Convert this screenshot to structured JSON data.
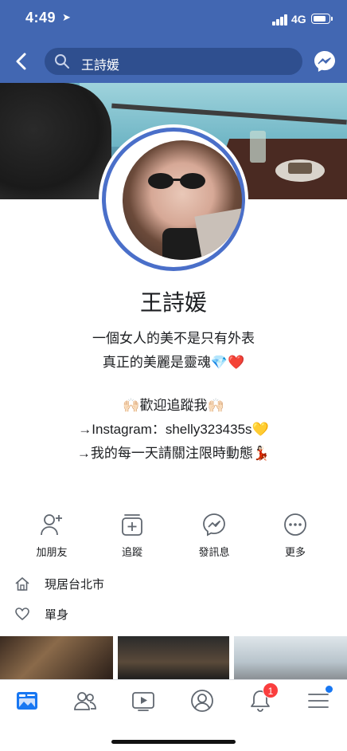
{
  "status_bar": {
    "time": "4:49",
    "network": "4G",
    "battery_level": 0.85
  },
  "header": {
    "search_query": "王詩媛",
    "icons": [
      "back-arrow-icon",
      "search-icon",
      "messenger-icon"
    ]
  },
  "profile": {
    "name": "王詩媛",
    "bio_lines": [
      "一個女人的美不是只有外表",
      "真正的美麗是靈魂💎❤️",
      "",
      "🙌🏻歡迎追蹤我🙌🏻",
      "→Instagram：shelly323435s💛",
      "→我的每一天請關注限時動態💃🏻"
    ]
  },
  "actions": [
    {
      "label": "加朋友",
      "icon": "add-friend-icon"
    },
    {
      "label": "追蹤",
      "icon": "follow-icon"
    },
    {
      "label": "發訊息",
      "icon": "messenger-icon"
    },
    {
      "label": "更多",
      "icon": "more-icon"
    }
  ],
  "info": {
    "location": "現居台北市",
    "relationship": "單身"
  },
  "tabbar": {
    "items": [
      "news-feed-icon",
      "friends-icon",
      "watch-icon",
      "profile-icon",
      "notifications-icon",
      "menu-icon"
    ],
    "notifications_badge": "1"
  },
  "colors": {
    "brand_blue": "#4267b2",
    "search_bg": "#2f4f8f",
    "avatar_ring": "#4a6fc9",
    "badge_red": "#fa3e3e",
    "active_tab": "#1877f2"
  }
}
